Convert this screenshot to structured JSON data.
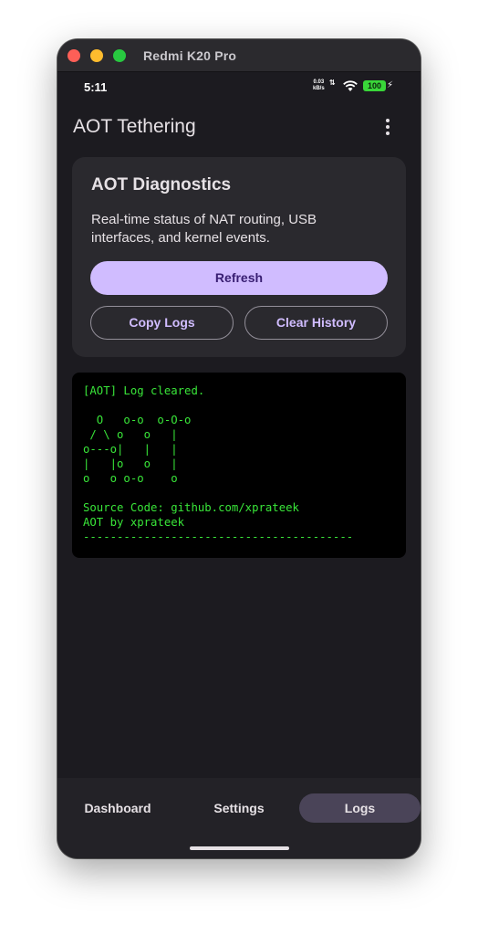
{
  "window": {
    "title": "Redmi K20 Pro"
  },
  "status_bar": {
    "time": "5:11",
    "net_speed_value": "0.03",
    "net_speed_unit": "kB/s",
    "battery": "100",
    "icons": [
      "wifi-icon",
      "battery-icon",
      "charging-bolt-icon"
    ]
  },
  "app_bar": {
    "title": "AOT Tethering",
    "menu_icon": "more-vert-icon"
  },
  "diagnostics": {
    "title": "AOT Diagnostics",
    "description": "Real-time status of NAT routing, USB interfaces, and kernel events.",
    "refresh_label": "Refresh",
    "copy_logs_label": "Copy Logs",
    "clear_history_label": "Clear History"
  },
  "console": {
    "text": "[AOT] Log cleared.\n\n  O   o-o  o-O-o\n / \\ o   o   |\no---o|   |   |\n|   |o   o   |\no   o o-o    o\n\nSource Code: github.com/xprateek\nAOT by xprateek\n----------------------------------------"
  },
  "bottom_nav": {
    "items": [
      {
        "label": "Dashboard",
        "selected": false
      },
      {
        "label": "Settings",
        "selected": false
      },
      {
        "label": "Logs",
        "selected": true
      }
    ]
  },
  "colors": {
    "background": "#1c1b20",
    "card": "#2a292e",
    "primary": "#d0bcff",
    "on_primary": "#381e72",
    "console_text": "#39e639",
    "nav_selected": "#4a4458"
  }
}
